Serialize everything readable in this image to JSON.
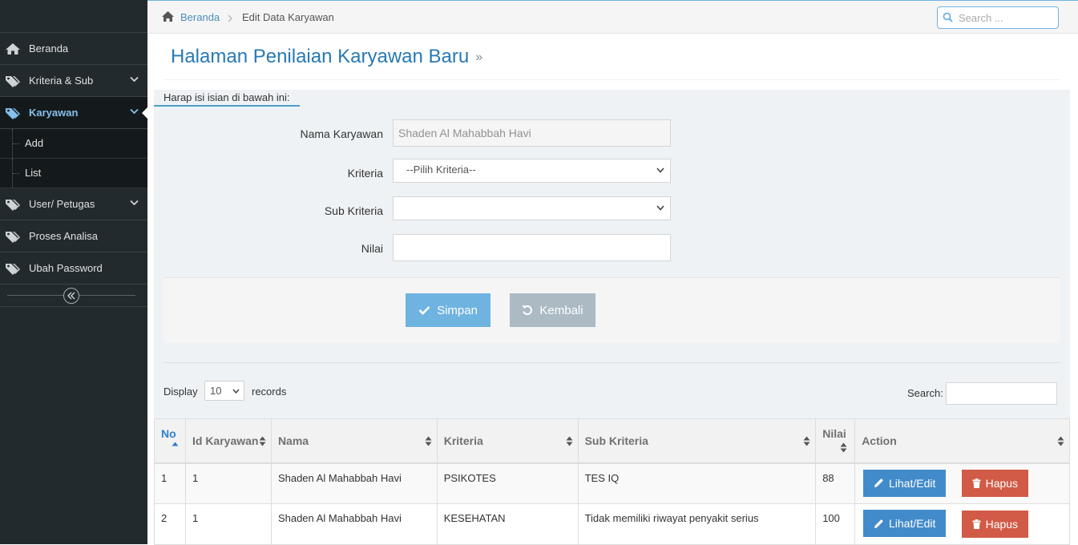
{
  "sidebar": {
    "items": [
      {
        "label": "Beranda",
        "icon": "home-icon"
      },
      {
        "label": "Kriteria & Sub",
        "icon": "tags-icon"
      },
      {
        "label": "Karyawan",
        "icon": "tags-icon"
      },
      {
        "label": "User/ Petugas",
        "icon": "tags-icon"
      },
      {
        "label": "Proses Analisa",
        "icon": "tags-icon"
      },
      {
        "label": "Ubah Password",
        "icon": "tags-icon"
      }
    ],
    "submenu": [
      "Add",
      "List"
    ]
  },
  "breadcrumb": {
    "home": "Beranda",
    "current": "Edit Data Karyawan"
  },
  "nav_search": {
    "placeholder": "Search ..."
  },
  "page": {
    "title": "Halaman Penilaian Karyawan Baru",
    "title_suffix": "»"
  },
  "form": {
    "tab_label": "Harap isi isian di bawah ini:",
    "nama_label": "Nama Karyawan",
    "nama_value": "Shaden Al Mahabbah Havi",
    "kriteria_label": "Kriteria",
    "kriteria_value": "--Pilih Kriteria--",
    "sub_kriteria_label": "Sub Kriteria",
    "sub_kriteria_value": "",
    "nilai_label": "Nilai",
    "nilai_value": "",
    "save_label": "Simpan",
    "back_label": "Kembali"
  },
  "table_controls": {
    "display_label": "Display",
    "display_value": "10",
    "records_label": "records",
    "search_label": "Search:"
  },
  "table": {
    "headers": [
      "No",
      "Id Karyawan",
      "Nama",
      "Kriteria",
      "Sub Kriteria",
      "Nilai",
      "Action"
    ],
    "rows": [
      {
        "no": "1",
        "id": "1",
        "nama": "Shaden Al Mahabbah Havi",
        "kriteria": "PSIKOTES",
        "sub": "TES IQ",
        "nilai": "88"
      },
      {
        "no": "2",
        "id": "1",
        "nama": "Shaden Al Mahabbah Havi",
        "kriteria": "KESEHATAN",
        "sub": "Tidak memiliki riwayat penyakit serius",
        "nilai": "100"
      }
    ],
    "edit_label": "Lihat/Edit",
    "delete_label": "Hapus"
  },
  "colors": {
    "sidebar_bg": "#222a2d",
    "accent_blue": "#6fb3e0",
    "title_blue": "#2679b5",
    "edit_blue": "#428bca",
    "delete_red": "#d15b47",
    "back_gray": "#abbac3"
  }
}
